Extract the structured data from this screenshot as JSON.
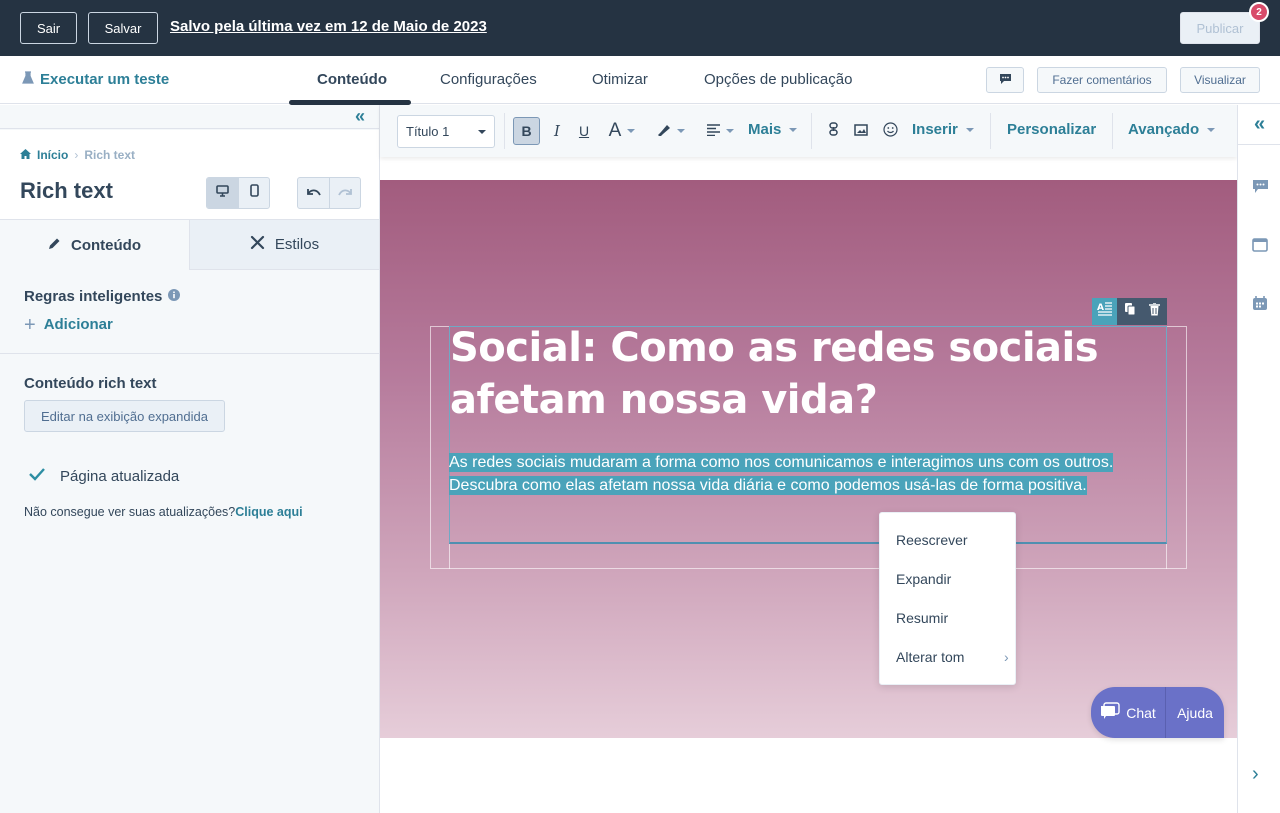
{
  "topbar": {
    "exit_label": "Sair",
    "save_label": "Salvar",
    "last_saved": "Salvo pela última vez em 12 de Maio de 2023",
    "publish_label": "Publicar",
    "publish_badge": "2"
  },
  "navbar": {
    "run_test": "Executar um teste",
    "tabs": [
      {
        "label": "Conteúdo",
        "active": true
      },
      {
        "label": "Configurações",
        "active": false
      },
      {
        "label": "Otimizar",
        "active": false
      },
      {
        "label": "Opções de publicação",
        "active": false
      }
    ],
    "comments_label": "Fazer comentários",
    "preview_label": "Visualizar"
  },
  "left_panel": {
    "breadcrumb": {
      "home": "Início",
      "current": "Rich text"
    },
    "title": "Rich text",
    "tabs": [
      {
        "label": "Conteúdo",
        "active": true
      },
      {
        "label": "Estilos",
        "active": false
      }
    ],
    "smart_rules_label": "Regras inteligentes",
    "add_label": "Adicionar",
    "rich_text_label": "Conteúdo rich text",
    "edit_expanded_label": "Editar na exibição expandida",
    "page_updated": "Página atualizada",
    "cant_see": "Não consegue ver suas atualizações?",
    "click_here": "Clique aqui"
  },
  "toolbar": {
    "style_value": "Título 1",
    "more_label": "Mais",
    "insert_label": "Inserir",
    "personalize_label": "Personalizar",
    "advanced_label": "Avançado"
  },
  "canvas": {
    "heading": "Social: Como as redes sociais afetam nossa vida?",
    "body": "As redes sociais mudaram a forma como nos comunicamos e interagimos uns com os outros. Descubra como elas afetam nossa vida diária e como podemos usá-las de forma positiva.",
    "gradient_top": "#a25c7e",
    "gradient_bottom": "#e6cdd9",
    "selection_color": "#4aa3ba"
  },
  "ai_menu": {
    "items": [
      "Reescrever",
      "Expandir",
      "Resumir",
      "Alterar tom"
    ]
  },
  "chat_widget": {
    "chat_label": "Chat",
    "help_label": "Ajuda"
  },
  "colors": {
    "accent": "#2d7f97",
    "topbar": "#253342",
    "badge": "#d84b6a"
  }
}
